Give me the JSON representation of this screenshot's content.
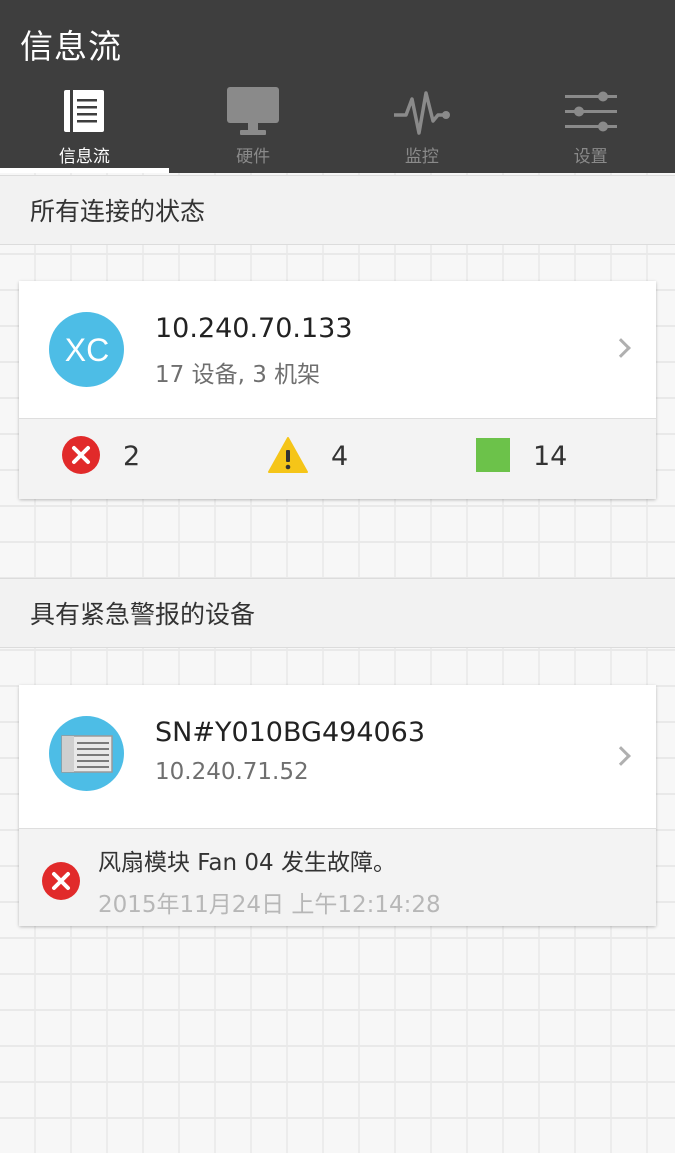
{
  "app": {
    "title": "信息流"
  },
  "tabs": [
    {
      "label": "信息流",
      "icon": "feed-icon",
      "active": true
    },
    {
      "label": "硬件",
      "icon": "monitor-icon",
      "active": false
    },
    {
      "label": "监控",
      "icon": "pulse-icon",
      "active": false
    },
    {
      "label": "设置",
      "icon": "sliders-icon",
      "active": false
    }
  ],
  "sections": {
    "connections": {
      "header": "所有连接的状态",
      "card": {
        "avatar_text": "XC",
        "avatar_color": "#4dbde6",
        "title": "10.240.70.133",
        "subtitle": "17 设备, 3 机架",
        "stats": {
          "error_count": "2",
          "warning_count": "4",
          "ok_count": "14"
        }
      }
    },
    "urgent": {
      "header": "具有紧急警报的设备",
      "card": {
        "avatar_icon": "server-icon",
        "avatar_color": "#4dbde6",
        "title": "SN#Y010BG494063",
        "subtitle": "10.240.71.52",
        "alert": {
          "message": "风扇模块 Fan 04 发生故障。",
          "time": "2015年11月24日 上午12:14:28"
        }
      }
    }
  },
  "colors": {
    "appbar": "#3e3e3e",
    "error": "#e12a2a",
    "warning": "#f5c518",
    "ok": "#6cc24a",
    "accent": "#4dbde6"
  }
}
